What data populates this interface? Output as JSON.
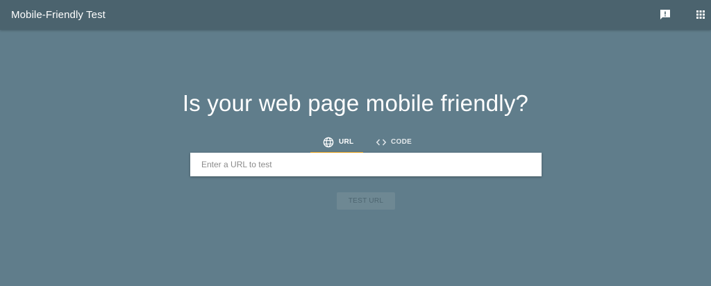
{
  "header": {
    "title": "Mobile-Friendly Test",
    "feedback_icon": "feedback-icon",
    "apps_icon": "apps-grid-icon"
  },
  "main": {
    "headline": "Is your web page mobile friendly?",
    "tabs": [
      {
        "label": "URL",
        "icon": "globe-icon",
        "selected": true
      },
      {
        "label": "CODE",
        "icon": "code-icon",
        "selected": false
      }
    ],
    "url_input": {
      "value": "",
      "placeholder": "Enter a URL to test"
    },
    "test_button": {
      "label": "TEST URL",
      "enabled": false
    }
  },
  "colors": {
    "background": "#607d8b",
    "header": "#4b636e",
    "tab_indicator": "#f2a818",
    "input_background": "#ffffff"
  }
}
